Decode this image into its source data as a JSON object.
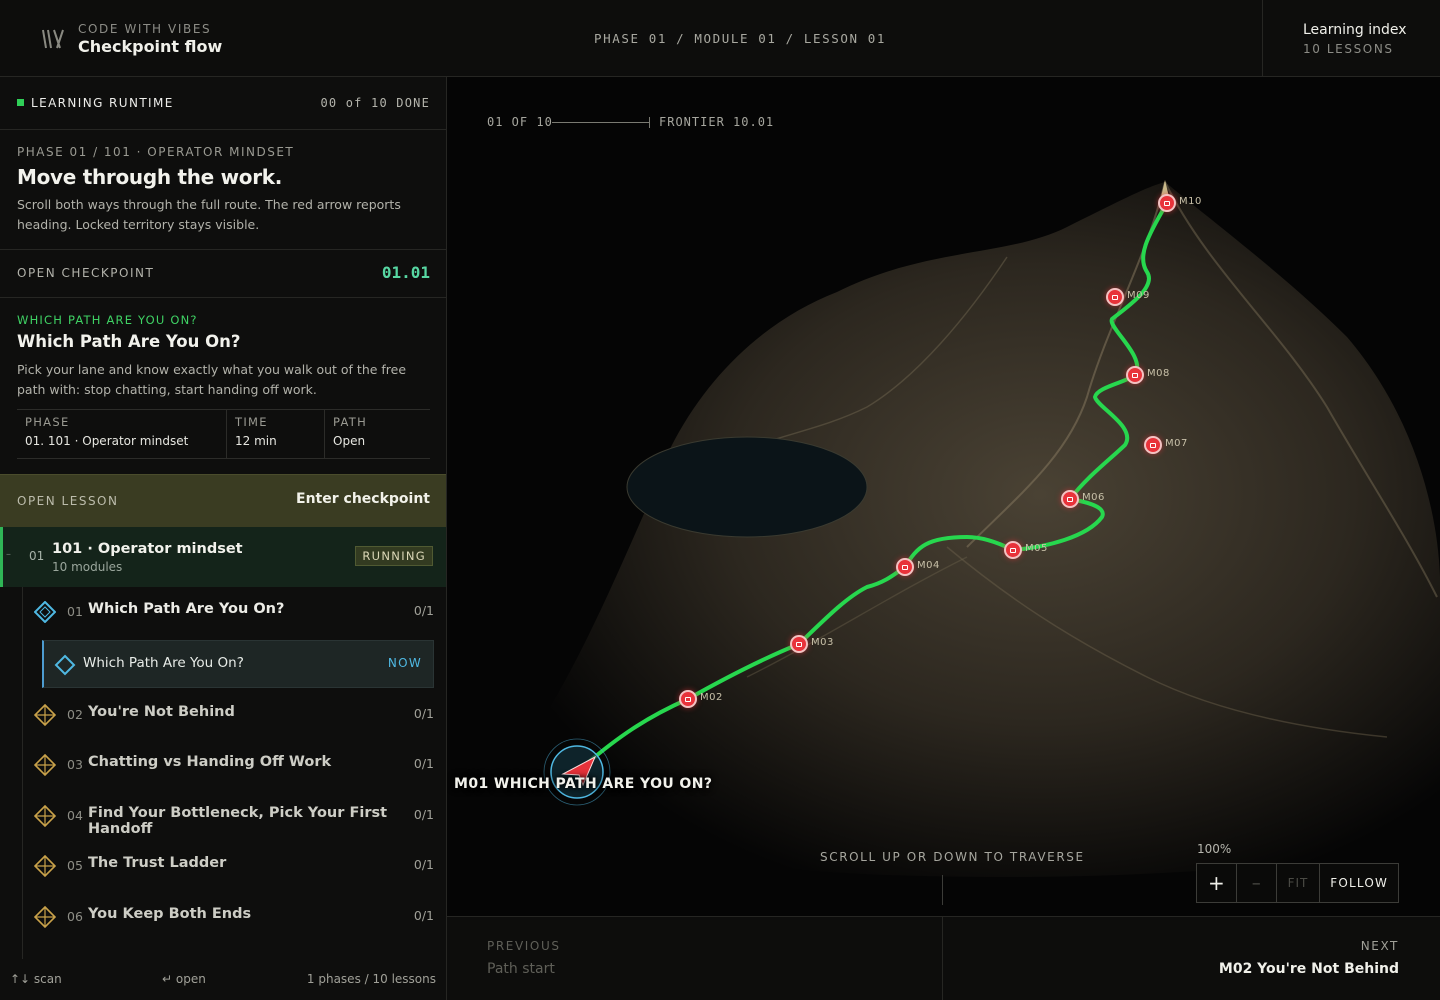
{
  "header": {
    "brand_eyebrow": "CODE WITH VIBES",
    "brand_title": "Checkpoint flow",
    "breadcrumb": "PHASE 01 / MODULE 01 / LESSON 01",
    "index_title": "Learning index",
    "index_count": "10 LESSONS"
  },
  "sidebar": {
    "runtime_label": "LEARNING RUNTIME",
    "runtime_count": "00 of 10 DONE",
    "phase_eyebrow": "PHASE 01 / 101 · OPERATOR MINDSET",
    "phase_title": "Move through the work.",
    "phase_desc": "Scroll both ways through the full route. The red arrow reports heading. Locked territory stays visible.",
    "checkpoint_label": "OPEN CHECKPOINT",
    "checkpoint_id": "01.01",
    "lesson": {
      "eyebrow": "WHICH PATH ARE YOU ON?",
      "title": "Which Path Are You On?",
      "desc": "Pick your lane and know exactly what you walk out of the free path with: stop chatting, start handing off work.",
      "meta": [
        {
          "key": "PHASE",
          "value": "01. 101 · Operator mindset"
        },
        {
          "key": "TIME",
          "value": "12 min"
        },
        {
          "key": "PATH",
          "value": "Open"
        }
      ]
    },
    "open_lesson_label": "OPEN LESSON",
    "open_lesson_action": "Enter checkpoint",
    "module": {
      "dash": "–",
      "num": "01",
      "title": "101 · Operator mindset",
      "sub": "10 modules",
      "badge": "RUNNING"
    },
    "items": [
      {
        "num": "01",
        "title": "Which Path Are You On?",
        "count": "0/1",
        "icon": "diamond-blue-icon"
      },
      {
        "num": "02",
        "title": "You're Not Behind",
        "count": "0/1",
        "icon": "diamond-gold-icon"
      },
      {
        "num": "03",
        "title": "Chatting vs Handing Off Work",
        "count": "0/1",
        "icon": "diamond-gold-icon"
      },
      {
        "num": "04",
        "title": "Find Your Bottleneck, Pick Your First Handoff",
        "count": "0/1",
        "icon": "diamond-gold-icon"
      },
      {
        "num": "05",
        "title": "The Trust Ladder",
        "count": "0/1",
        "icon": "diamond-gold-icon"
      },
      {
        "num": "06",
        "title": "You Keep Both Ends",
        "count": "0/1",
        "icon": "diamond-gold-icon"
      }
    ],
    "sub_item": {
      "title": "Which Path Are You On?",
      "status": "NOW"
    },
    "footer": {
      "scan": "↑↓ scan",
      "open": "↵ open",
      "info": "1 phases / 10 lessons"
    }
  },
  "map": {
    "progress": "01 OF 10",
    "frontier": "FRONTIER 10.01",
    "current_label": "M01 WHICH PATH ARE YOU ON?",
    "markers": [
      "M02",
      "M03",
      "M04",
      "M05",
      "M06",
      "M07",
      "M08",
      "M09",
      "M10"
    ],
    "scroll_hint": "SCROLL UP OR DOWN TO TRAVERSE",
    "zoom_level": "100%",
    "zoom_in": "+",
    "zoom_out": "–",
    "zoom_fit": "FIT",
    "zoom_follow": "FOLLOW",
    "colors": {
      "path": "#27d74e",
      "marker": "#e8323a",
      "current": "#4fb8e2"
    }
  },
  "nav": {
    "prev_label": "PREVIOUS",
    "prev_title": "Path start",
    "next_label": "NEXT",
    "next_title": "M02 You're Not Behind"
  }
}
